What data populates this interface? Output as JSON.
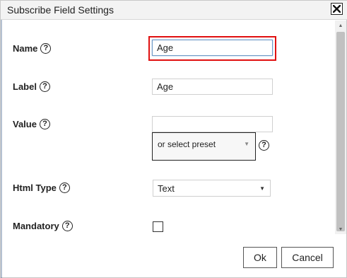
{
  "dialog": {
    "title": "Subscribe Field Settings",
    "close_icon": "close-icon"
  },
  "fields": {
    "name": {
      "label": "Name",
      "value": "Age"
    },
    "label": {
      "label": "Label",
      "value": "Age"
    },
    "value": {
      "label": "Value",
      "value": "",
      "preset_placeholder": "or select preset"
    },
    "html_type": {
      "label": "Html Type",
      "selected": "Text"
    },
    "mandatory": {
      "label": "Mandatory",
      "checked": false
    }
  },
  "help_glyph": "?",
  "buttons": {
    "ok": "Ok",
    "cancel": "Cancel"
  },
  "colors": {
    "highlight": "#e01010",
    "titlebar": "#f3f3f3"
  }
}
